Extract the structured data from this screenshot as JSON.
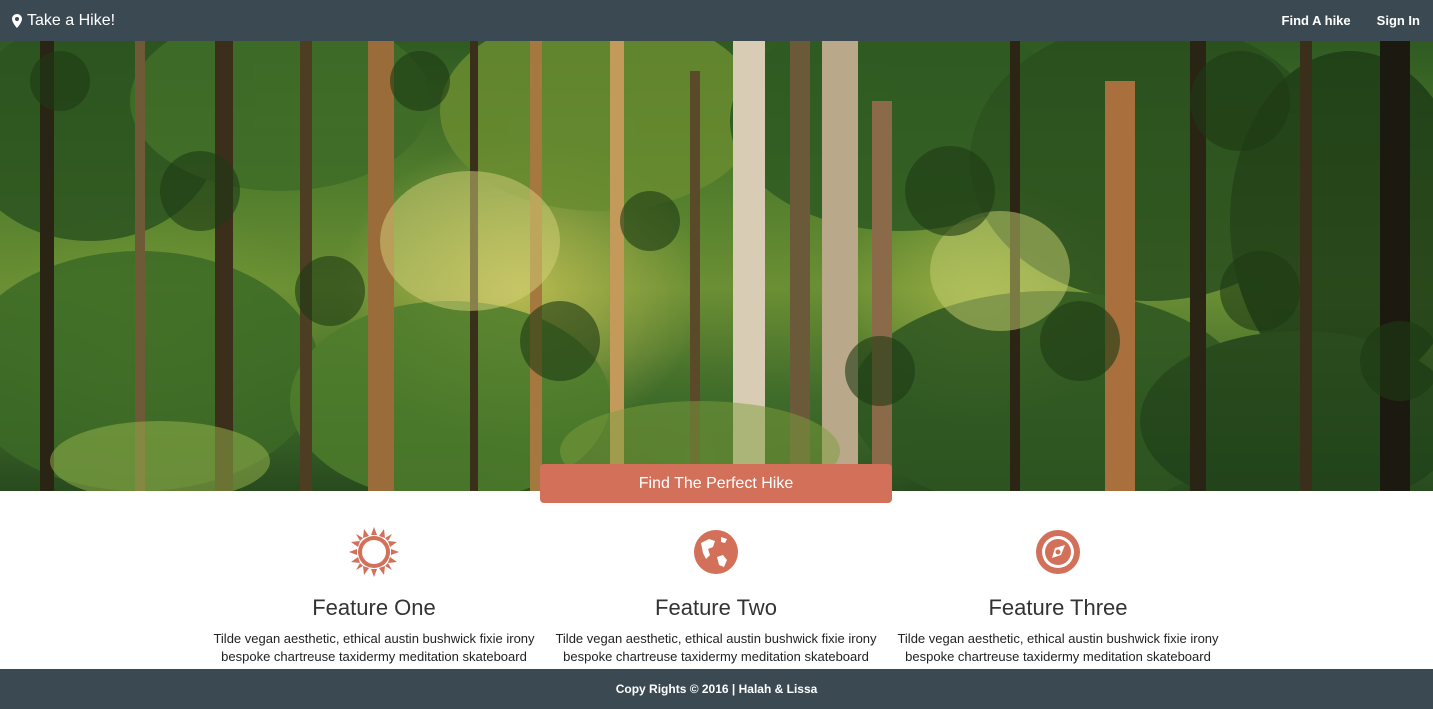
{
  "navbar": {
    "brand": "Take a Hike!",
    "links": [
      "Find A hike",
      "Sign In"
    ]
  },
  "hero": {
    "cta_label": "Find The Perfect Hike"
  },
  "features": [
    {
      "icon": "sun-icon",
      "title": "Feature One",
      "text": "Tilde vegan aesthetic, ethical austin bushwick fixie irony bespoke chartreuse taxidermy meditation skateboard"
    },
    {
      "icon": "globe-icon",
      "title": "Feature Two",
      "text": "Tilde vegan aesthetic, ethical austin bushwick fixie irony bespoke chartreuse taxidermy meditation skateboard"
    },
    {
      "icon": "compass-icon",
      "title": "Feature Three",
      "text": "Tilde vegan aesthetic, ethical austin bushwick fixie irony bespoke chartreuse taxidermy meditation skateboard"
    }
  ],
  "footer": {
    "text": "Copy Rights © 2016 | Halah & Lissa"
  },
  "colors": {
    "navbar": "#3b4a52",
    "accent": "#d2705a",
    "footer": "#3b4a52"
  }
}
